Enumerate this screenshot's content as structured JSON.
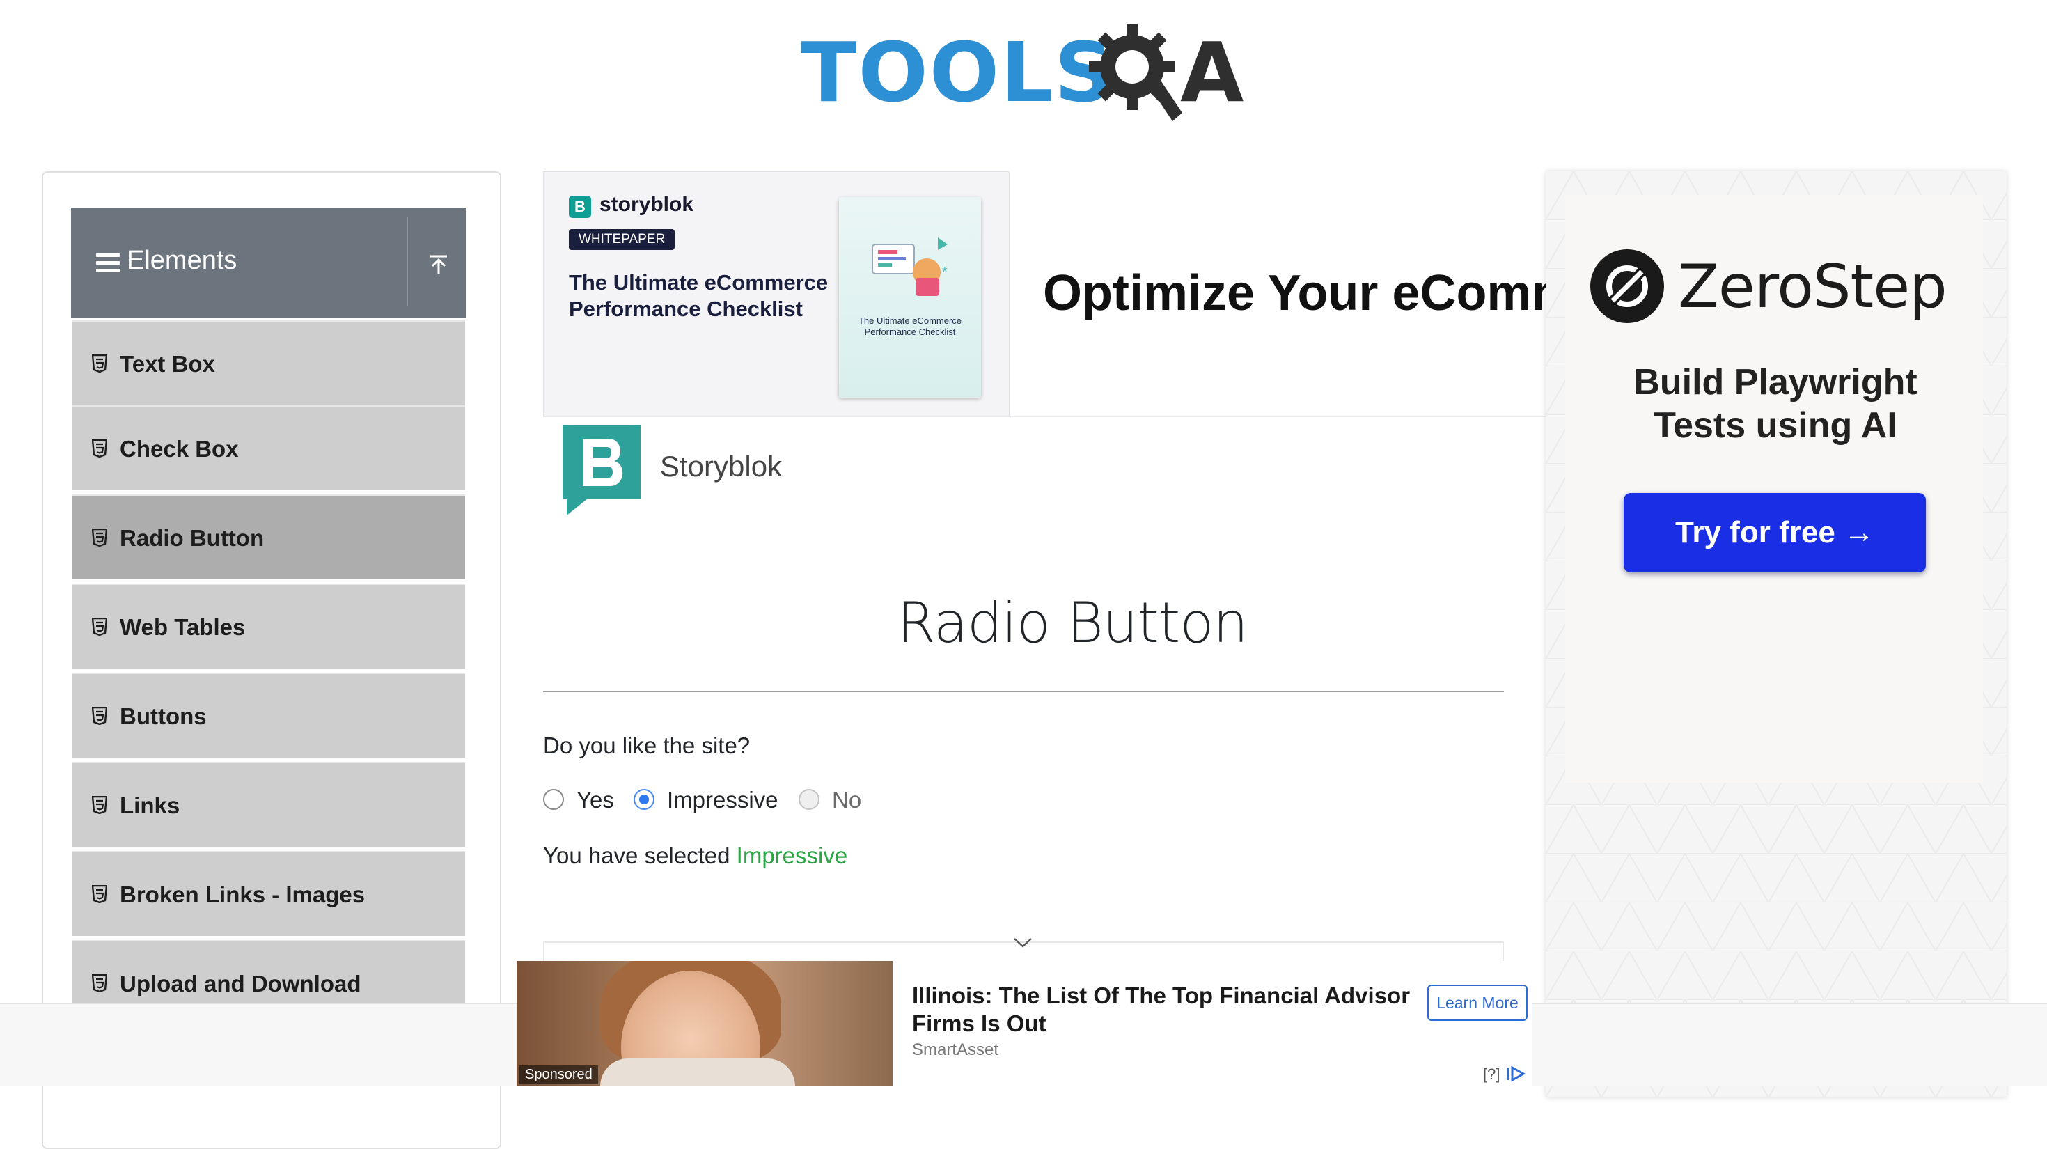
{
  "header": {
    "logo_text": "TOOLS",
    "logo_suffix": "A"
  },
  "sidebar": {
    "group_title": "Elements",
    "items": [
      {
        "label": "Text Box"
      },
      {
        "label": "Check Box"
      },
      {
        "label": "Radio Button",
        "active": true
      },
      {
        "label": "Web Tables"
      },
      {
        "label": "Buttons"
      },
      {
        "label": "Links"
      },
      {
        "label": "Broken Links - Images"
      },
      {
        "label": "Upload and Download"
      }
    ]
  },
  "top_ad": {
    "brand": "storyblok",
    "pill": "WHITEPAPER",
    "headline": "The Ultimate eCommerce Performance Checklist",
    "book_title": "The Ultimate eCommerce Performance Checklist",
    "tagline": "Optimize Your eComm",
    "advertiser": "Storyblok"
  },
  "main": {
    "title": "Radio Button",
    "question": "Do you like the site?",
    "options": [
      {
        "label": "Yes",
        "checked": false,
        "disabled": false
      },
      {
        "label": "Impressive",
        "checked": true,
        "disabled": false
      },
      {
        "label": "No",
        "checked": false,
        "disabled": true
      }
    ],
    "result_prefix": "You have selected ",
    "result_value": "Impressive"
  },
  "right_ad": {
    "brand": "ZeroStep",
    "tagline_line1": "Build Playwright",
    "tagline_line2": "Tests using AI",
    "cta": "Try for free →"
  },
  "sponsored": {
    "tag": "Sponsored",
    "title": "Illinois: The List Of The Top Financial Advisor Firms Is Out",
    "source": "SmartAsset",
    "button": "Learn More",
    "q": "[?]"
  },
  "colors": {
    "sidebar_header": "#6c757d",
    "menu_item": "#cecece",
    "menu_item_active": "#adadad",
    "radio_accent": "#2f78f0",
    "success_text": "#28a745",
    "logo_blue": "#2d8fd4",
    "cta_blue": "#1a2fe5"
  }
}
